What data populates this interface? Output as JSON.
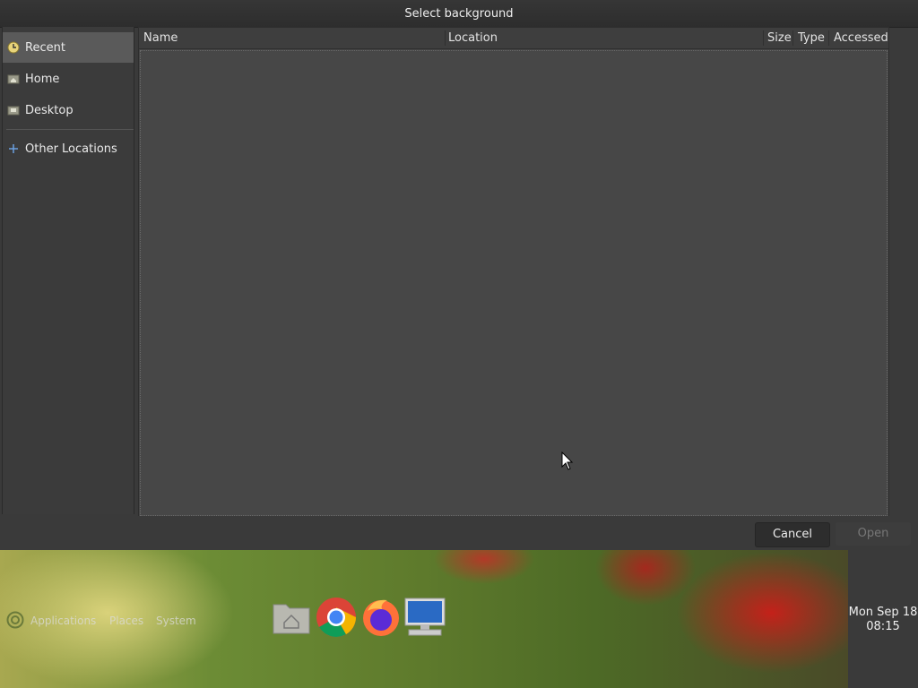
{
  "dialog": {
    "title": "Select background",
    "sidebar": {
      "items": [
        {
          "label": "Recent",
          "icon": "recent-clock-icon",
          "selected": true
        },
        {
          "label": "Home",
          "icon": "home-folder-icon"
        },
        {
          "label": "Desktop",
          "icon": "desktop-folder-icon"
        },
        {
          "label": "Other Locations",
          "icon": "plus-icon"
        }
      ]
    },
    "file_list": {
      "columns": [
        "Name",
        "Location",
        "Size",
        "Type",
        "Accessed"
      ],
      "rows": []
    },
    "buttons": {
      "cancel": "Cancel",
      "open": "Open"
    }
  },
  "panel": {
    "menus": [
      "Applications",
      "Places",
      "System"
    ],
    "launchers": [
      "home-folder-icon",
      "chrome-icon",
      "firefox-icon",
      "computer-monitor-icon"
    ],
    "clock": {
      "date": "Mon Sep 18",
      "time": "08:15"
    }
  },
  "colors": {
    "dialog_bg": "#3a3a3a",
    "selected_item": "#5a5a5a",
    "cancel_button": "#2d2d2d"
  }
}
